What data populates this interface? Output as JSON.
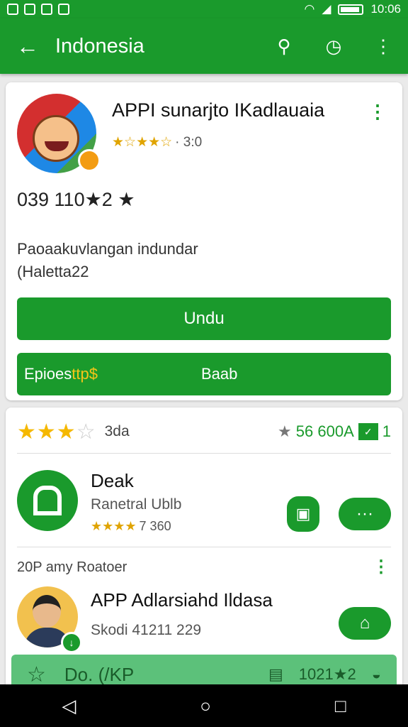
{
  "status_bar": {
    "time": "10:06"
  },
  "app_bar": {
    "back_icon": "←",
    "title": "Indonesia",
    "search_icon": "⚲",
    "history_icon": "◷",
    "menu_icon": "⋮"
  },
  "featured": {
    "name": "APPI sunarjto IKadlauaia",
    "stars": "★☆★★☆",
    "rating": "· 3:0",
    "menu_icon": "⋮",
    "stats": "039  110★2 ★",
    "desc_line1": "Paoaakuvlangan indundar",
    "desc_line2": "(Haletta22",
    "install_label": "Undu",
    "extra_left": "Epioes",
    "extra_left_highlight": "ttp$",
    "extra_right": "Baab"
  },
  "rating_row": {
    "stars_on": "★★★",
    "stars_off": "☆",
    "label": "3da",
    "right_star": "★",
    "right_text": "56 600A",
    "right_badge": "✓",
    "right_num": "1"
  },
  "list_item_1": {
    "title": "Deak",
    "subtitle": "Ranetral Ublb",
    "stars": "★★★★",
    "rating": "7 360",
    "bag_icon": "▣",
    "chat_icon": "···"
  },
  "section": {
    "label": "20P amy Roatoer",
    "menu_icon": "⋮"
  },
  "list_item_2": {
    "title": "APP Adlarsiahd Ildasa",
    "subtitle": "Skodi 41211 229",
    "badge_icon": "↓",
    "home_icon": "⌂"
  },
  "bottom_strip": {
    "star_icon": "☆",
    "label": "Do. (/KP",
    "gift_icon": "▤",
    "count": "1021★2",
    "cake_icon": "◒"
  },
  "nav": {
    "back": "◁",
    "home": "○",
    "recent": "□"
  }
}
